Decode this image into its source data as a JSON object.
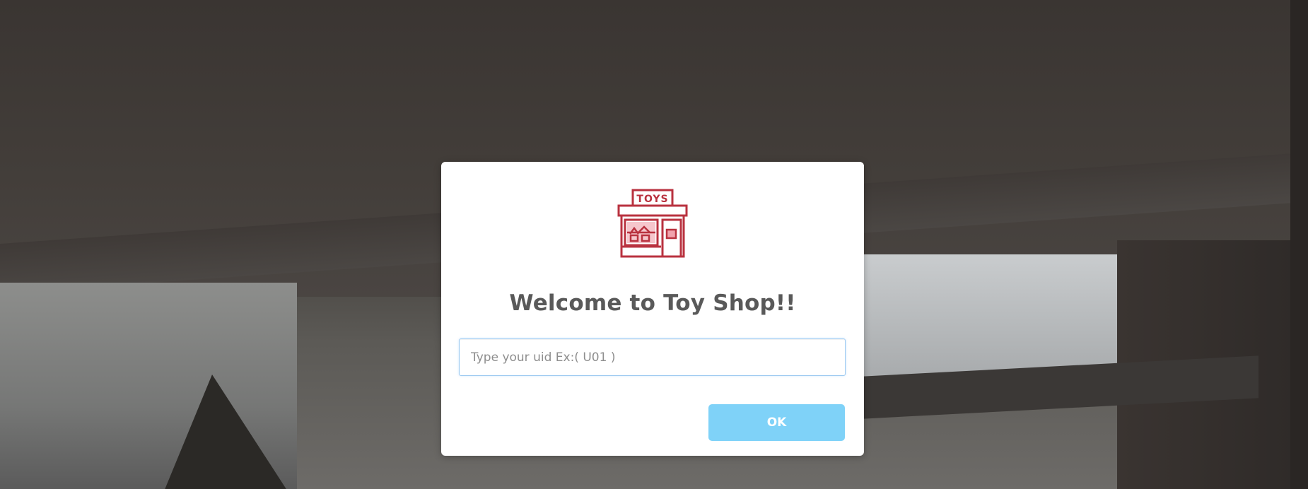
{
  "background": {
    "icon": "room-photo-background"
  },
  "modal": {
    "icon": "toy-shop-storefront-icon",
    "icon_sign_text": "TOYS",
    "title": "Welcome to Toy Shop!!",
    "input": {
      "value": "",
      "placeholder": "Type your uid Ex:( U01 )"
    },
    "ok_label": "OK"
  },
  "colors": {
    "icon_red": "#b9323f",
    "ok_button": "#7fd2f8",
    "title_text": "#595959",
    "input_border": "#9dcaf1"
  }
}
